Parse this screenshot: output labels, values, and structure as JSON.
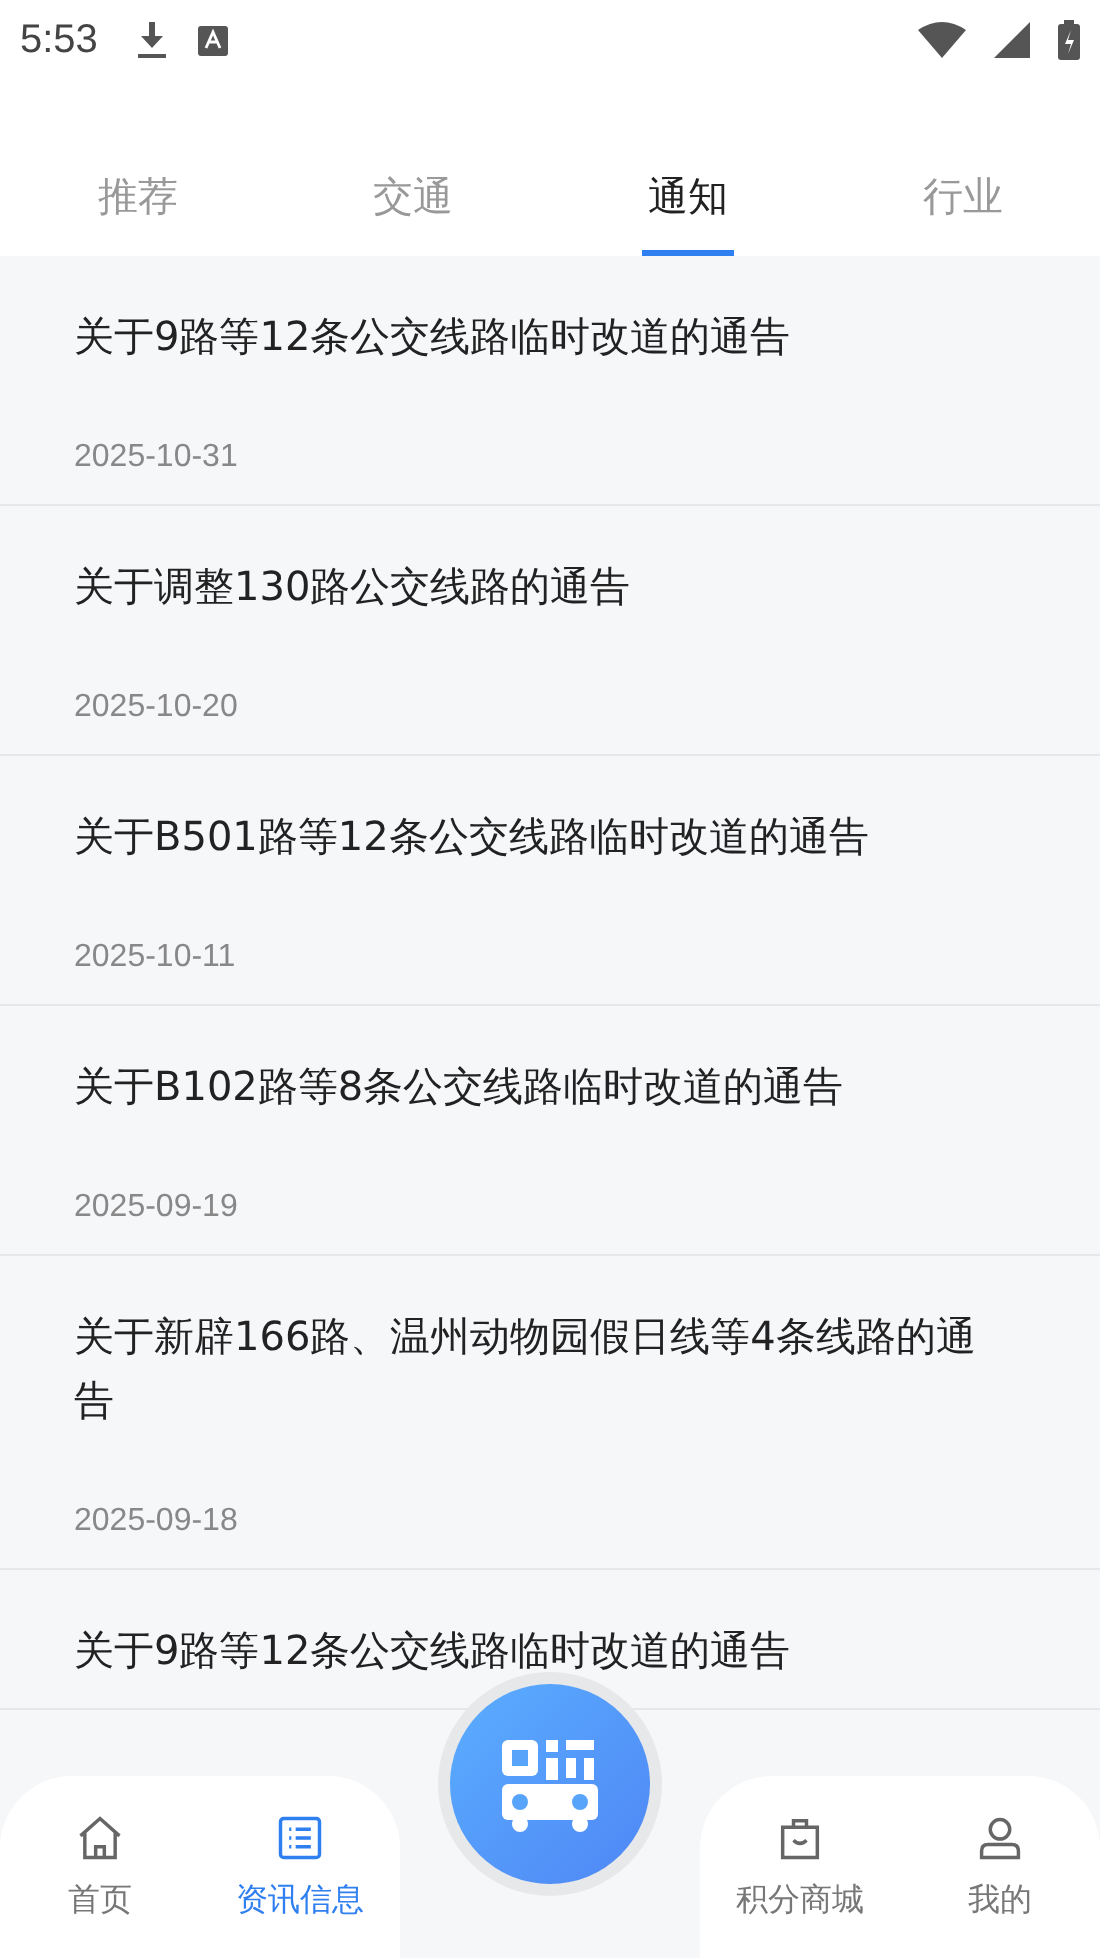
{
  "status_bar": {
    "time": "5:53"
  },
  "tabs": [
    {
      "label": "推荐",
      "selected": false
    },
    {
      "label": "交通",
      "selected": false
    },
    {
      "label": "通知",
      "selected": true
    },
    {
      "label": "行业",
      "selected": false
    }
  ],
  "notices": [
    {
      "title": "关于9路等12条公交线路临时改道的通告",
      "date": "2025-10-31"
    },
    {
      "title": "关于调整130路公交线路的通告",
      "date": "2025-10-20"
    },
    {
      "title": "关于B501路等12条公交线路临时改道的通告",
      "date": "2025-10-11"
    },
    {
      "title": "关于B102路等8条公交线路临时改道的通告",
      "date": "2025-09-19"
    },
    {
      "title": "关于新辟166路、温州动物园假日线等4条线路的通告",
      "date": "2025-09-18"
    },
    {
      "title": "关于9路等12条公交线路临时改道的通告"
    }
  ],
  "bottom_nav": [
    {
      "kind": "home",
      "label": "首页",
      "selected": false
    },
    {
      "kind": "news",
      "label": "资讯信息",
      "selected": true
    },
    {
      "kind": "scan",
      "selected": false
    },
    {
      "kind": "shop",
      "label": "积分商城",
      "selected": false
    },
    {
      "kind": "profile",
      "label": "我的",
      "selected": false
    }
  ]
}
